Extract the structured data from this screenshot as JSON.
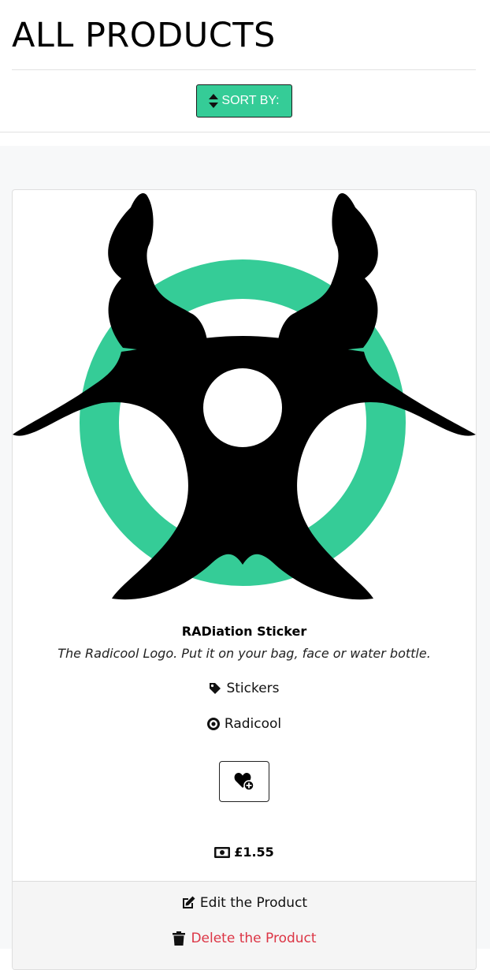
{
  "page": {
    "title": "ALL PRODUCTS"
  },
  "sort": {
    "label": "SORT BY:",
    "icon": "sort-icon"
  },
  "product": {
    "name": "RADiation Sticker",
    "description": "The Radicool Logo. Put it on your bag, face or water bottle.",
    "category": {
      "label": "Stickers",
      "icon": "tag-icon"
    },
    "brand": {
      "label": "Radicool",
      "icon": "bullseye-icon"
    },
    "wishlist_icon": "heart-plus-icon",
    "price": "£1.55",
    "price_icon": "money-bill-icon",
    "image_icon": "biohazard-icon"
  },
  "actions": {
    "edit_label": "Edit the Product",
    "delete_label": "Delete the Product"
  },
  "colors": {
    "accent": "#35cc97",
    "danger": "#dc3545",
    "card_footer_bg": "#f5f5f5",
    "page_bg": "#f7f8f9"
  }
}
